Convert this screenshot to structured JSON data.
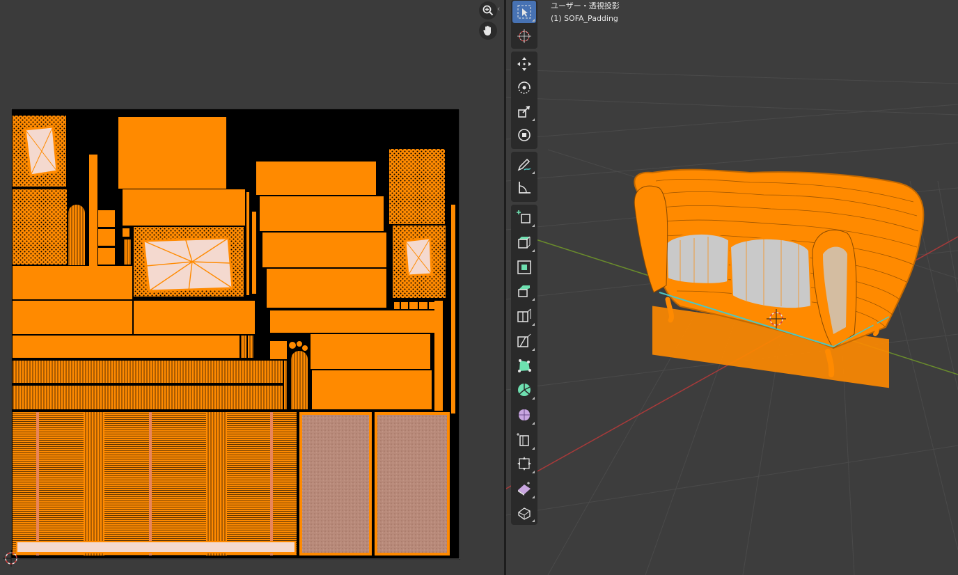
{
  "viewport": {
    "view_label": "ユーザー・透視投影",
    "object_label": "(1) SOFA_Padding"
  },
  "uv_editor": {
    "icons": [
      "zoom-icon",
      "hand-pan-icon"
    ],
    "mesh_color": "#ff8a00",
    "background": "#000000"
  },
  "toolbar": {
    "tools": [
      "select-box-icon",
      "cursor-icon",
      "move-icon",
      "rotate-icon",
      "scale-icon",
      "transform-icon",
      "annotate-icon",
      "measure-icon",
      "add-cube-icon",
      "extrude-region-icon",
      "inset-faces-icon",
      "bevel-icon",
      "loop-cut-icon",
      "knife-icon",
      "poly-build-icon",
      "spin-icon",
      "smooth-icon",
      "edge-slide-icon",
      "shrink-fatten-icon",
      "shear-icon",
      "rip-region-icon"
    ],
    "active_color": "#4772b3"
  },
  "colors": {
    "accent": "#ff8a00",
    "axis_x": "#a83a3a",
    "axis_y": "#6a8c2c"
  }
}
